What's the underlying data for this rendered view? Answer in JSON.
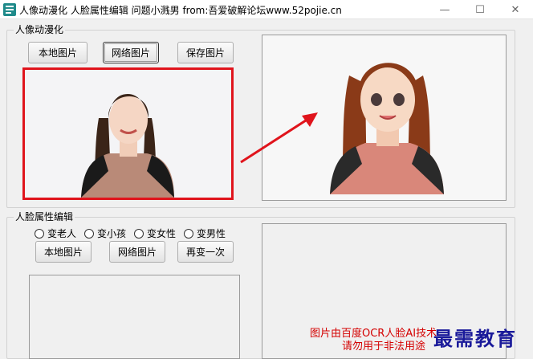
{
  "window": {
    "title": "人像动漫化 人脸属性编辑 问题小溅男 from:吾爱破解论坛www.52pojie.cn",
    "min_glyph": "—",
    "max_glyph": "☐",
    "close_glyph": "✕"
  },
  "anime_group": {
    "label": "人像动漫化",
    "local_button": "本地图片",
    "network_button": "网络图片",
    "save_button": "保存图片"
  },
  "face_group": {
    "label": "人脸属性编辑",
    "options": [
      "变老人",
      "变小孩",
      "变女性",
      "变男性"
    ],
    "local_button": "本地图片",
    "network_button": "网络图片",
    "again_button": "再变一次"
  },
  "notice": {
    "line1": "图片由百度OCR人脸AI技术",
    "line2": "请勿用于非法用途"
  },
  "watermark": "最需教育",
  "colors": {
    "accent_red": "#e0141c",
    "notice_red": "#d40000"
  }
}
